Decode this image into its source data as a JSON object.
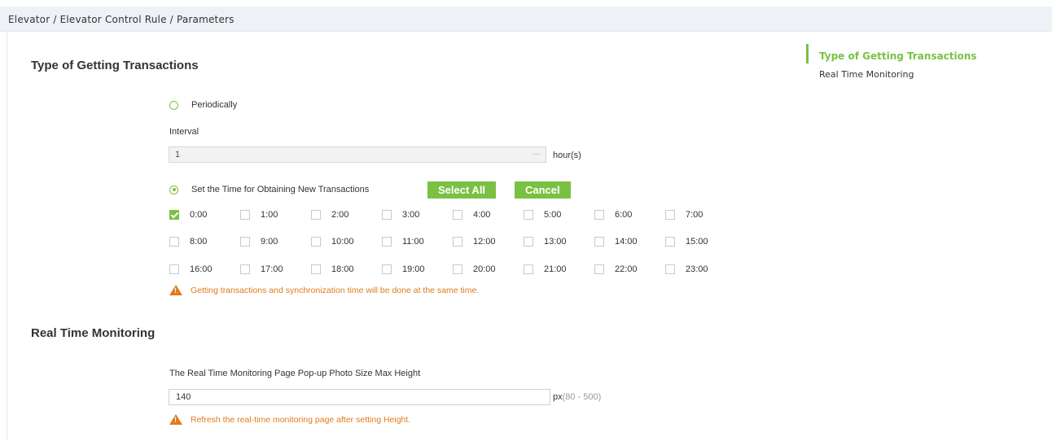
{
  "breadcrumb": "Elevator / Elevator Control Rule / Parameters",
  "colors": {
    "accent": "#7ac143",
    "warning": "#e07b1c"
  },
  "transactions": {
    "title": "Type of Getting Transactions",
    "periodically_label": "Periodically",
    "periodically_checked": false,
    "interval_label": "Interval",
    "interval_value": "1",
    "interval_unit": "hour(s)",
    "set_time_label": "Set the Time for Obtaining New Transactions",
    "set_time_checked": true,
    "select_all_label": "Select All",
    "cancel_label": "Cancel",
    "hours": [
      {
        "label": "0:00",
        "checked": true
      },
      {
        "label": "1:00",
        "checked": false
      },
      {
        "label": "2:00",
        "checked": false
      },
      {
        "label": "3:00",
        "checked": false
      },
      {
        "label": "4:00",
        "checked": false
      },
      {
        "label": "5:00",
        "checked": false
      },
      {
        "label": "6:00",
        "checked": false
      },
      {
        "label": "7:00",
        "checked": false
      },
      {
        "label": "8:00",
        "checked": false
      },
      {
        "label": "9:00",
        "checked": false
      },
      {
        "label": "10:00",
        "checked": false
      },
      {
        "label": "11:00",
        "checked": false
      },
      {
        "label": "12:00",
        "checked": false
      },
      {
        "label": "13:00",
        "checked": false
      },
      {
        "label": "14:00",
        "checked": false
      },
      {
        "label": "15:00",
        "checked": false
      },
      {
        "label": "16:00",
        "checked": false
      },
      {
        "label": "17:00",
        "checked": false
      },
      {
        "label": "18:00",
        "checked": false
      },
      {
        "label": "19:00",
        "checked": false
      },
      {
        "label": "20:00",
        "checked": false
      },
      {
        "label": "21:00",
        "checked": false
      },
      {
        "label": "22:00",
        "checked": false
      },
      {
        "label": "23:00",
        "checked": false
      }
    ],
    "warning": "Getting transactions and synchronization time will be done at the same time."
  },
  "monitoring": {
    "title": "Real Time Monitoring",
    "photo_size_label": "The Real Time Monitoring Page Pop-up Photo Size  Max Height",
    "height_value": "140",
    "unit": "px",
    "range": "(80 - 500)",
    "warning": "Refresh the real-time monitoring page after setting Height."
  },
  "anchor_nav": {
    "items": [
      "Type of Getting Transactions",
      "Real Time Monitoring"
    ]
  }
}
